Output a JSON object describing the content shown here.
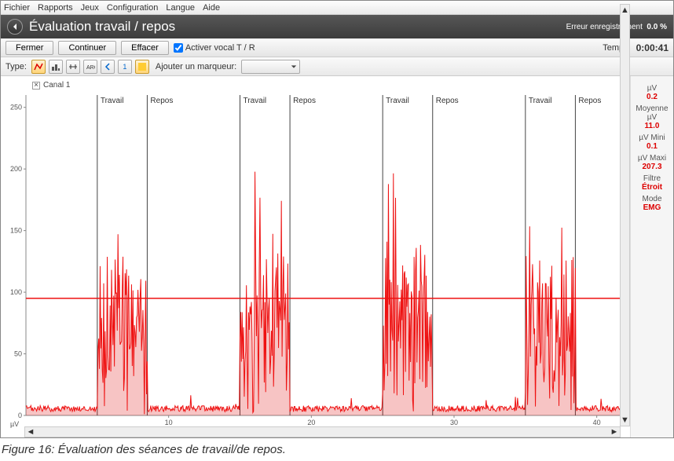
{
  "menubar": [
    "Fichier",
    "Rapports",
    "Jeux",
    "Configuration",
    "Langue",
    "Aide"
  ],
  "title": "Évaluation travail / repos",
  "status_label": "Erreur enregistrement",
  "status_value": "0.0 %",
  "buttons": {
    "close": "Fermer",
    "continue": "Continuer",
    "clear": "Effacer"
  },
  "checkbox_label": "Activer vocal T / R",
  "timer_label": "Temps",
  "timer_value": "0:00:41",
  "type_label": "Type:",
  "marker_label": "Ajouter un marqueur:",
  "channel_label": "Canal 1",
  "phase_labels": {
    "work": "Travail",
    "rest": "Repos"
  },
  "stats": {
    "uv_label": "µV",
    "uv": "0.2",
    "avg_label": "Moyenne µV",
    "avg": "11.0",
    "min_label": "µV Mini",
    "min": "0.1",
    "max_label": "µV Maxi",
    "max": "207.3",
    "filter_label": "Filtre",
    "filter": "Étroit",
    "mode_label": "Mode",
    "mode": "EMG"
  },
  "caption": "Figure 16: Évaluation des séances de travail/de repos.",
  "chart_data": {
    "type": "line",
    "xlabel": "",
    "ylabel": "µV",
    "xlim": [
      0,
      42
    ],
    "ylim": [
      0,
      260
    ],
    "x_ticks": [
      10,
      20,
      30,
      40
    ],
    "y_ticks": [
      0,
      50,
      100,
      150,
      200,
      250
    ],
    "threshold": 95,
    "phases": [
      {
        "label": "Travail",
        "start": 5,
        "end": 8.5
      },
      {
        "label": "Repos",
        "start": 8.5,
        "end": 15
      },
      {
        "label": "Travail",
        "start": 15,
        "end": 18.5
      },
      {
        "label": "Repos",
        "start": 18.5,
        "end": 25
      },
      {
        "label": "Travail",
        "start": 25,
        "end": 28.5
      },
      {
        "label": "Repos",
        "start": 28.5,
        "end": 35
      },
      {
        "label": "Travail",
        "start": 35,
        "end": 38.5
      },
      {
        "label": "Repos",
        "start": 38.5,
        "end": 42
      }
    ],
    "series": [
      {
        "name": "Canal 1",
        "color": "#e11",
        "baseline_low": 3,
        "baseline_high": 8,
        "work_low": 30,
        "work_high": 130,
        "work_spike_max": 205
      }
    ]
  }
}
